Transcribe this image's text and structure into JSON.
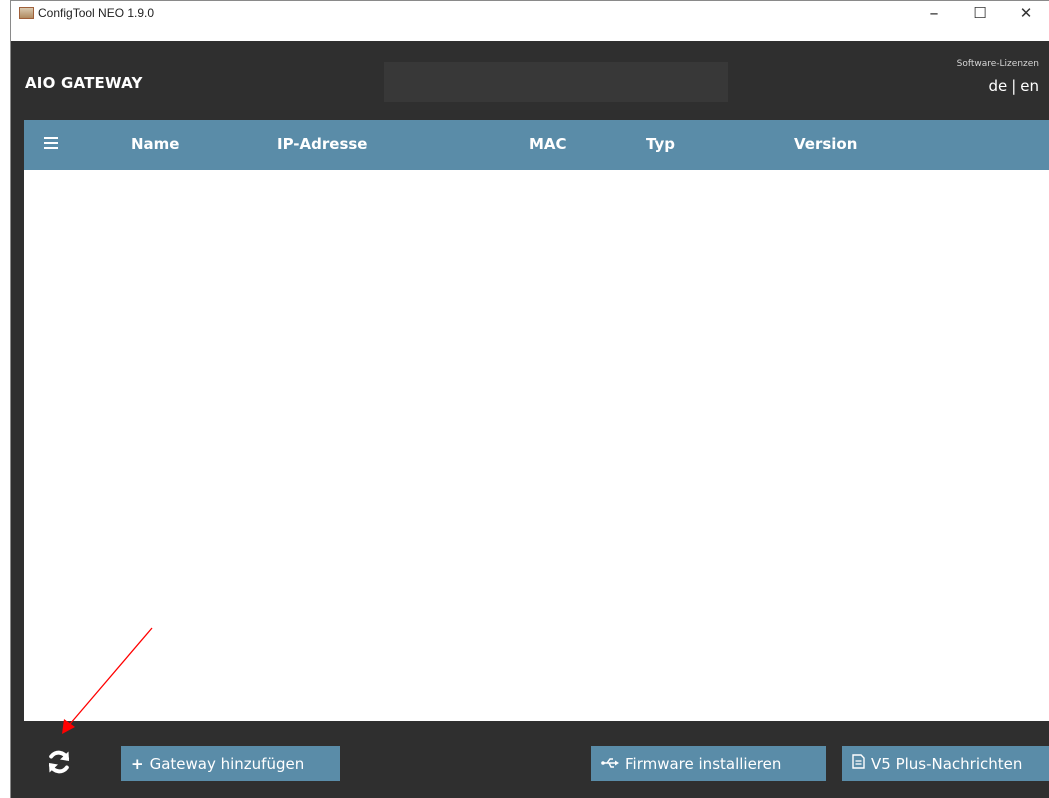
{
  "window": {
    "title": "ConfigTool NEO 1.9.0",
    "controls": {
      "minimize": "–",
      "maximize": "☐",
      "close": "✕"
    }
  },
  "header": {
    "app_title": "AIO GATEWAY",
    "license_link": "Software-Lizenzen",
    "languages": {
      "de": "de",
      "separator": "|",
      "en": "en"
    }
  },
  "table": {
    "columns": [
      "Name",
      "IP-Adresse",
      "MAC",
      "Typ",
      "Version"
    ],
    "rows": []
  },
  "footer": {
    "add_gateway": "Gateway hinzufügen",
    "install_firmware": "Firmware installieren",
    "v5_messages": "V5 Plus-Nachrichten"
  },
  "icons": {
    "menu": "hamburger-menu-icon",
    "refresh": "refresh-icon",
    "plus": "plus-icon",
    "usb": "usb-icon",
    "document": "document-icon"
  },
  "colors": {
    "header_bg": "#2f2f2f",
    "accent": "#5a8ca8",
    "annotation_arrow": "#ff0000"
  }
}
